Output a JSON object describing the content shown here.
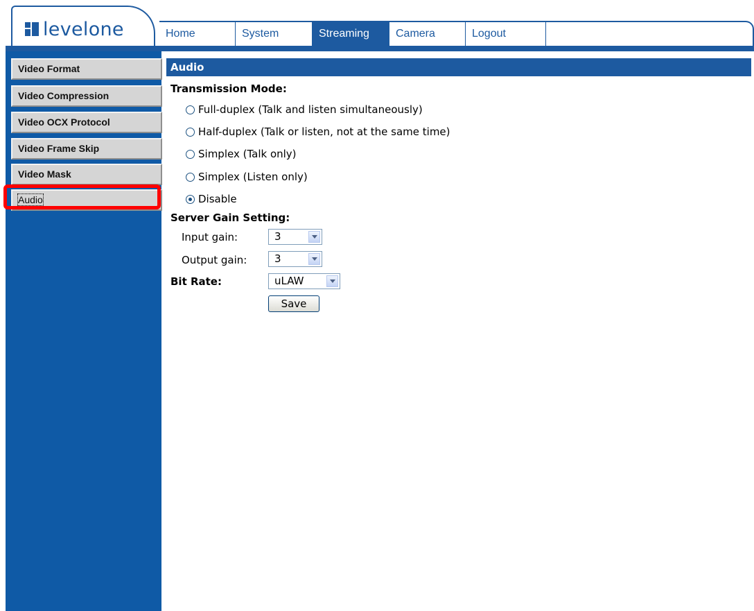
{
  "brand": {
    "logo_text": "levelone",
    "accent": "#1d5aa0"
  },
  "nav": {
    "tabs": [
      {
        "label": "Home",
        "active": false
      },
      {
        "label": "System",
        "active": false
      },
      {
        "label": "Streaming",
        "active": true
      },
      {
        "label": "Camera",
        "active": false
      },
      {
        "label": "Logout",
        "active": false
      }
    ]
  },
  "sidebar": {
    "items": [
      {
        "label": "Video Format"
      },
      {
        "label": "Video Compression"
      },
      {
        "label": "Video OCX Protocol"
      },
      {
        "label": "Video Frame Skip"
      },
      {
        "label": "Video Mask"
      },
      {
        "label": "Audio",
        "selected": true,
        "highlight_color": "#ff0000"
      }
    ]
  },
  "main": {
    "section_title": "Audio",
    "transmission_mode": {
      "label": "Transmission Mode:",
      "options": [
        {
          "label": "Full-duplex (Talk and listen simultaneously)",
          "checked": false
        },
        {
          "label": "Half-duplex (Talk or listen, not at the same time)",
          "checked": false
        },
        {
          "label": "Simplex (Talk only)",
          "checked": false
        },
        {
          "label": "Simplex (Listen only)",
          "checked": false
        },
        {
          "label": "Disable",
          "checked": true
        }
      ]
    },
    "server_gain": {
      "label": "Server Gain Setting:",
      "input_gain_label": "Input gain:",
      "input_gain_value": "3",
      "output_gain_label": "Output gain:",
      "output_gain_value": "3"
    },
    "bit_rate": {
      "label": "Bit Rate:",
      "value": "uLAW"
    },
    "save_label": "Save"
  }
}
